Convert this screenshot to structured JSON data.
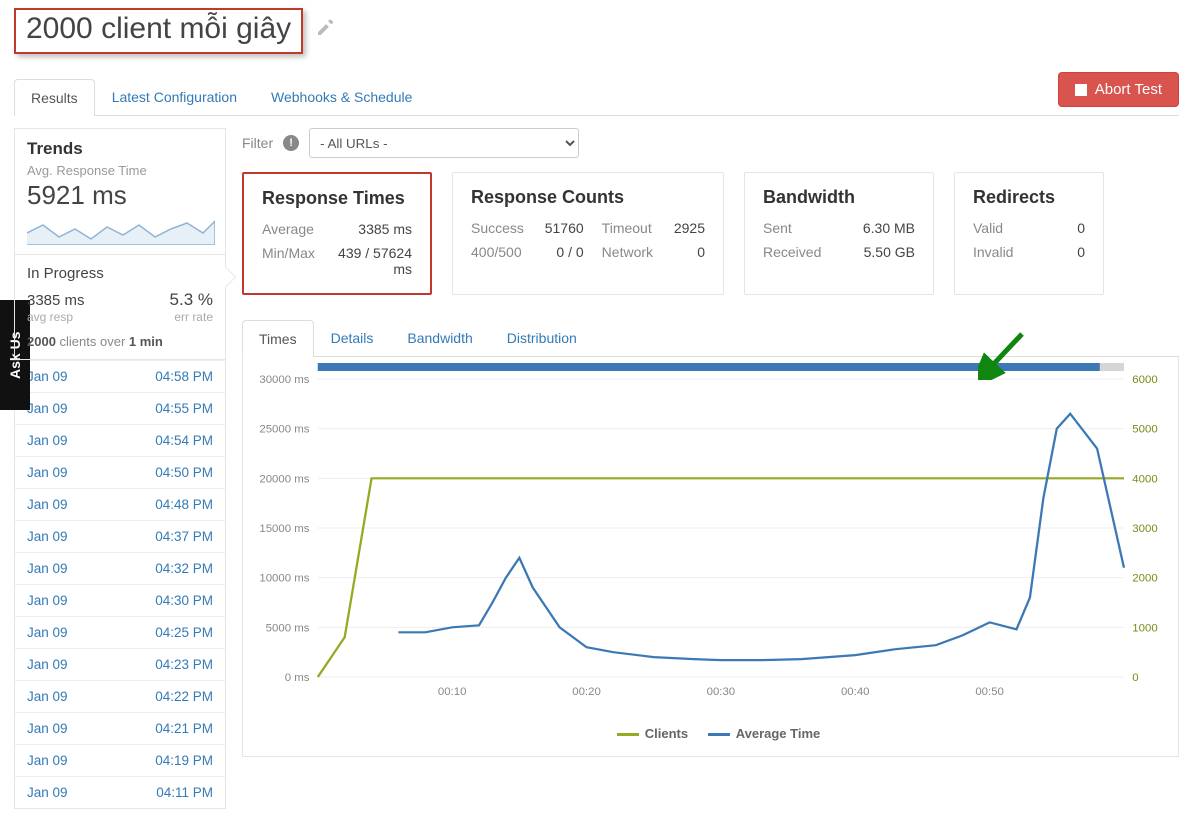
{
  "title": "2000 client mỗi giây",
  "askus": "Ask Us",
  "abort_label": "Abort Test",
  "top_tabs": [
    "Results",
    "Latest Configuration",
    "Webhooks & Schedule"
  ],
  "active_top_tab": 0,
  "sidebar": {
    "trends_title": "Trends",
    "avg_label": "Avg. Response Time",
    "avg_value": "5921 ms",
    "in_progress": "In Progress",
    "avg_resp_val": "3385 ms",
    "avg_resp_sub": "avg resp",
    "err_rate_val": "5.3 %",
    "err_rate_sub": "err rate",
    "run_clients": "2000",
    "run_mid": " clients over ",
    "run_dur": "1 min",
    "history": [
      {
        "d": "Jan 09",
        "t": "04:58 PM"
      },
      {
        "d": "Jan 09",
        "t": "04:55 PM"
      },
      {
        "d": "Jan 09",
        "t": "04:54 PM"
      },
      {
        "d": "Jan 09",
        "t": "04:50 PM"
      },
      {
        "d": "Jan 09",
        "t": "04:48 PM"
      },
      {
        "d": "Jan 09",
        "t": "04:37 PM"
      },
      {
        "d": "Jan 09",
        "t": "04:32 PM"
      },
      {
        "d": "Jan 09",
        "t": "04:30 PM"
      },
      {
        "d": "Jan 09",
        "t": "04:25 PM"
      },
      {
        "d": "Jan 09",
        "t": "04:23 PM"
      },
      {
        "d": "Jan 09",
        "t": "04:22 PM"
      },
      {
        "d": "Jan 09",
        "t": "04:21 PM"
      },
      {
        "d": "Jan 09",
        "t": "04:19 PM"
      },
      {
        "d": "Jan 09",
        "t": "04:11 PM"
      }
    ]
  },
  "filter": {
    "label": "Filter",
    "selected": "- All URLs -"
  },
  "cards": {
    "response_times": {
      "title": "Response Times",
      "rows": [
        {
          "k": "Average",
          "v": "3385 ms"
        },
        {
          "k": "Min/Max",
          "v": "439 / 57624 ms"
        }
      ]
    },
    "response_counts": {
      "title": "Response Counts",
      "rows": [
        {
          "k": "Success",
          "v": "51760",
          "k2": "Timeout",
          "v2": "2925"
        },
        {
          "k": "400/500",
          "v": "0 / 0",
          "k2": "Network",
          "v2": "0"
        }
      ]
    },
    "bandwidth": {
      "title": "Bandwidth",
      "rows": [
        {
          "k": "Sent",
          "v": "6.30 MB"
        },
        {
          "k": "Received",
          "v": "5.50 GB"
        }
      ]
    },
    "redirects": {
      "title": "Redirects",
      "rows": [
        {
          "k": "Valid",
          "v": "0"
        },
        {
          "k": "Invalid",
          "v": "0"
        }
      ]
    }
  },
  "chart_tabs": [
    "Times",
    "Details",
    "Bandwidth",
    "Distribution"
  ],
  "active_chart_tab": 0,
  "legend": {
    "clients": "Clients",
    "avg": "Average Time"
  },
  "colors": {
    "clients": "#97a821",
    "avg": "#3b78b5",
    "accent": "#d9534f",
    "annot": "#108510"
  },
  "chart_data": {
    "type": "line",
    "title": "",
    "x_ticks": [
      "00:10",
      "00:20",
      "00:30",
      "00:40",
      "00:50"
    ],
    "y_left": {
      "label": "ms",
      "min": 0,
      "max": 30000,
      "step": 5000
    },
    "y_right": {
      "label": "",
      "min": 0,
      "max": 6000,
      "step": 1000
    },
    "x": [
      0,
      2,
      4,
      6,
      8,
      10,
      12,
      13,
      14,
      15,
      16,
      18,
      20,
      22,
      25,
      28,
      30,
      33,
      36,
      40,
      43,
      46,
      48,
      50,
      52,
      53,
      54,
      55,
      56,
      58,
      60
    ],
    "series": [
      {
        "name": "Clients",
        "axis": "right",
        "color": "#97a821",
        "values": [
          0,
          800,
          4000,
          4000,
          4000,
          4000,
          4000,
          4000,
          4000,
          4000,
          4000,
          4000,
          4000,
          4000,
          4000,
          4000,
          4000,
          4000,
          4000,
          4000,
          4000,
          4000,
          4000,
          4000,
          4000,
          4000,
          4000,
          4000,
          4000,
          4000,
          4000
        ]
      },
      {
        "name": "Average Time",
        "axis": "left",
        "color": "#3b78b5",
        "values": [
          null,
          null,
          null,
          4500,
          4500,
          5000,
          5200,
          7500,
          10000,
          12000,
          9000,
          5000,
          3000,
          2500,
          2000,
          1800,
          1700,
          1700,
          1800,
          2200,
          2800,
          3200,
          4200,
          5500,
          4800,
          8000,
          18000,
          25000,
          26500,
          23000,
          11000
        ]
      }
    ]
  }
}
